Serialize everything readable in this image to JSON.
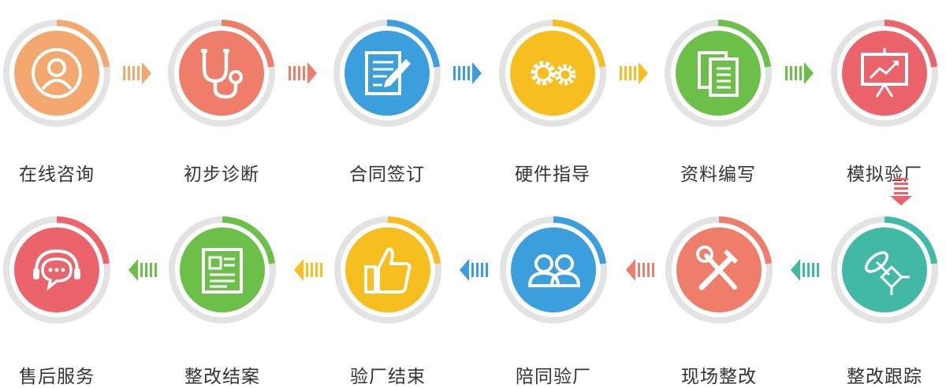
{
  "steps": [
    {
      "label": "在线咨询",
      "color": "#F2A86F",
      "icon": "user-icon"
    },
    {
      "label": "初步诊断",
      "color": "#EE7E6A",
      "icon": "stethoscope-icon"
    },
    {
      "label": "合同签订",
      "color": "#3A9FDC",
      "icon": "contract-sign-icon"
    },
    {
      "label": "硬件指导",
      "color": "#F6BE1E",
      "icon": "gears-icon"
    },
    {
      "label": "资料编写",
      "color": "#6CC04A",
      "icon": "documents-icon"
    },
    {
      "label": "模拟验厂",
      "color": "#EC646B",
      "icon": "presentation-chart-icon"
    },
    {
      "label": "整改跟踪",
      "color": "#41B9A4",
      "icon": "satellite-dish-icon"
    },
    {
      "label": "现场整改",
      "color": "#EE7E6A",
      "icon": "tools-icon"
    },
    {
      "label": "陪同验厂",
      "color": "#3A9FDC",
      "icon": "people-icon"
    },
    {
      "label": "验厂结束",
      "color": "#F6BE1E",
      "icon": "thumbs-up-icon"
    },
    {
      "label": "整改结案",
      "color": "#6CC04A",
      "icon": "report-document-icon"
    },
    {
      "label": "售后服务",
      "color": "#EC646B",
      "icon": "headset-chat-icon"
    }
  ],
  "colors": {
    "track": "#E3E3E3",
    "text": "#333333"
  }
}
